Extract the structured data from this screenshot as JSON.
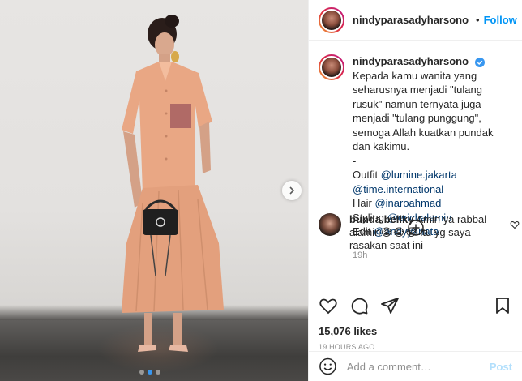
{
  "header": {
    "username": "nindyparasadyharsono",
    "separator": "•",
    "follow_label": "Follow"
  },
  "caption": {
    "username": "nindyparasadyharsono",
    "text": "Kepada kamu wanita yang seharusnya menjadi \"tulang rusuk\" namun ternyata juga menjadi \"tulang punggung\", semoga Allah kuatkan pundak dan kakimu.",
    "dash": "-",
    "credits": [
      {
        "label": "Outfit ",
        "handle": "@lumine.jakarta"
      },
      {
        "label": "",
        "handle": "@time.international"
      },
      {
        "label": "Hair ",
        "handle": "@inaroahmad"
      },
      {
        "label": "Styling ",
        "handle": "@erichalamin"
      },
      {
        "label": "Edit ",
        "handle": "@andyyanata"
      }
    ],
    "time": "19h"
  },
  "comment": {
    "username": "bunda.bellky",
    "text_line1": "Amin ya rabbal",
    "text_line2": "alamin😭😭😭 itu yg saya",
    "text_line3": "rasakan saat ini"
  },
  "stats": {
    "likes": "15,076 likes",
    "posted": "19 HOURS AGO"
  },
  "add_comment": {
    "placeholder": "Add a comment…",
    "post_label": "Post"
  },
  "carousel": {
    "slide_count": 3,
    "active_index": 1
  },
  "colors": {
    "accent": "#0095f6",
    "mention": "#00376b",
    "muted": "#8e8e8e",
    "post_disabled": "#b2dffc",
    "outfit": "#e9a784"
  },
  "icons": [
    "verified-badge-icon",
    "chevron-right-icon",
    "plus-circle-icon",
    "heart-icon",
    "comment-icon",
    "share-icon",
    "bookmark-icon",
    "emoji-icon"
  ]
}
